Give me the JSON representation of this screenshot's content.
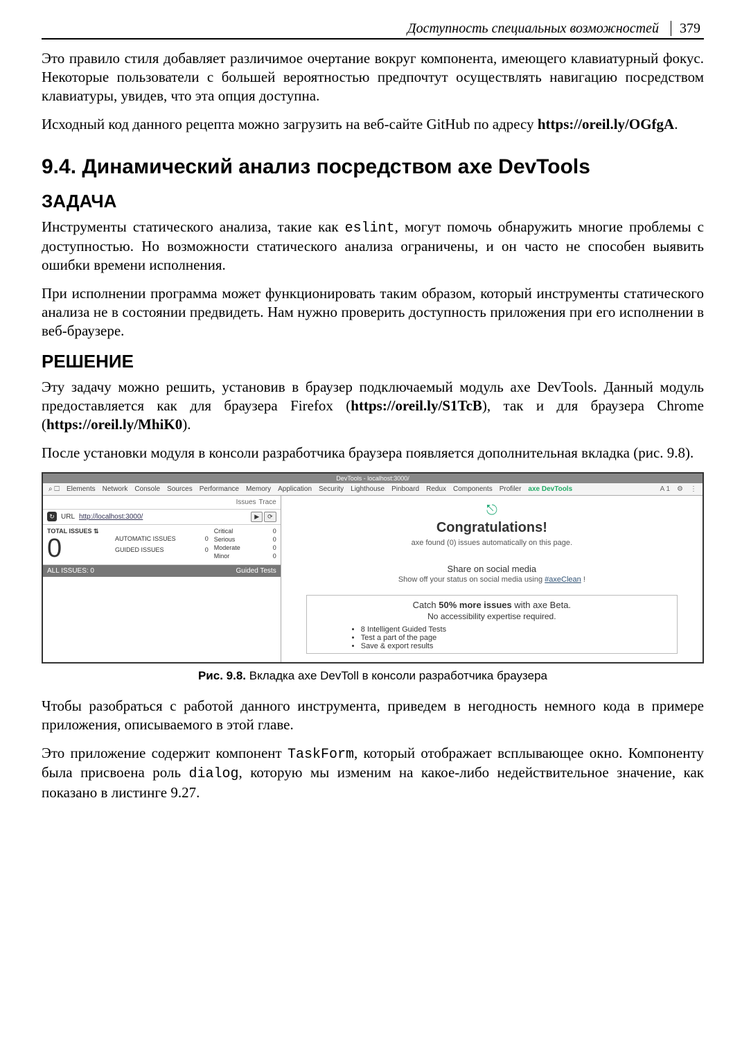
{
  "header": {
    "chapter": "Доступность специальных возможностей",
    "page": "379"
  },
  "para1": "Это правило стиля добавляет различимое очертание вокруг компонента, имеющего клавиатурный фокус. Некоторые пользователи с большей вероятностью предпочтут осуществлять навигацию посредством клавиатуры, увидев, что эта опция доступна.",
  "para2_a": "Исходный код данного рецепта можно загрузить на веб-сайте GitHub по адресу ",
  "para2_b": "https://oreil.ly/OGfgA",
  "para2_c": ".",
  "section_title": "9.4. Динамический анализ посредством axe DevTools",
  "h_zadacha": "ЗАДАЧА",
  "para3_a": "Инструменты статического анализа, такие как ",
  "para3_code": "eslint",
  "para3_b": ", могут помочь обнаружить многие проблемы с доступностью. Но возможности статического анализа ограничены, и он часто не способен выявить ошибки времени исполнения.",
  "para4": "При исполнении программа может функционировать таким образом, который инструменты статического анализа не в состоянии предвидеть. Нам нужно проверить доступность приложения при его исполнении в веб-браузере.",
  "h_reshenie": "РЕШЕНИЕ",
  "para5_a": "Эту задачу можно решить, установив в браузер подключаемый модуль axe DevTools. Данный модуль предоставляется как для браузера Firefox (",
  "para5_link1": "https://oreil.ly/S1TcB",
  "para5_b": "), так и для браузера Chrome (",
  "para5_link2": "https://oreil.ly/MhiK0",
  "para5_c": ").",
  "para6": "После установки модуля в консоли разработчика браузера появляется дополнительная вкладка (рис. 9.8).",
  "devtools": {
    "window_title": "DevTools - localhost:3000/",
    "tabs": [
      "Elements",
      "Network",
      "Console",
      "Sources",
      "Performance",
      "Memory",
      "Application",
      "Security",
      "Lighthouse",
      "Pinboard",
      "Redux",
      "Components",
      "Profiler",
      "axe DevTools"
    ],
    "right_badge": "A 1",
    "sub_tabs": [
      "Issues",
      "Trace"
    ],
    "url_label": "URL",
    "url_value": "http://localhost:3000/",
    "scan_btn1": "▶",
    "scan_btn2": "⟳",
    "total_label": "TOTAL ISSUES",
    "total_value": "0",
    "issue_types": [
      {
        "label": "AUTOMATIC ISSUES",
        "value": "0"
      },
      {
        "label": "GUIDED ISSUES",
        "value": "0"
      }
    ],
    "severity": [
      {
        "label": "Critical",
        "value": "0"
      },
      {
        "label": "Serious",
        "value": "0"
      },
      {
        "label": "Moderate",
        "value": "0"
      },
      {
        "label": "Minor",
        "value": "0"
      }
    ],
    "all_issues_label": "ALL ISSUES: 0",
    "guided_tests_label": "Guided Tests",
    "congrats": "Congratulations!",
    "congrats_sub": "axe found (0) issues automatically on this page.",
    "share_title": "Share on social media",
    "share_sub_a": "Show off your status on social media using ",
    "share_hash": "#axeClean",
    "share_sub_b": " !",
    "promo_headline_a": "Catch ",
    "promo_headline_b": "50% more issues",
    "promo_headline_c": " with axe Beta.",
    "promo_sub": "No accessibility expertise required.",
    "promo_bullets": [
      "8 Intelligent Guided Tests",
      "Test a part of the page",
      "Save & export results"
    ]
  },
  "fig_caption_label": "Рис. 9.8.",
  "fig_caption_text": " Вкладка axe DevToll в консоли разработчика браузера",
  "para7": "Чтобы разобраться с работой данного инструмента, приведем в негодность немного кода в примере приложения, описываемого в этой главе.",
  "para8_a": "Это приложение содержит компонент ",
  "para8_code1": "TaskForm",
  "para8_b": ", который отображает всплывающее окно. Компоненту была присвоена роль ",
  "para8_code2": "dialog",
  "para8_c": ", которую мы изменим на какое-либо недействительное значение, как показано в листинге 9.27."
}
